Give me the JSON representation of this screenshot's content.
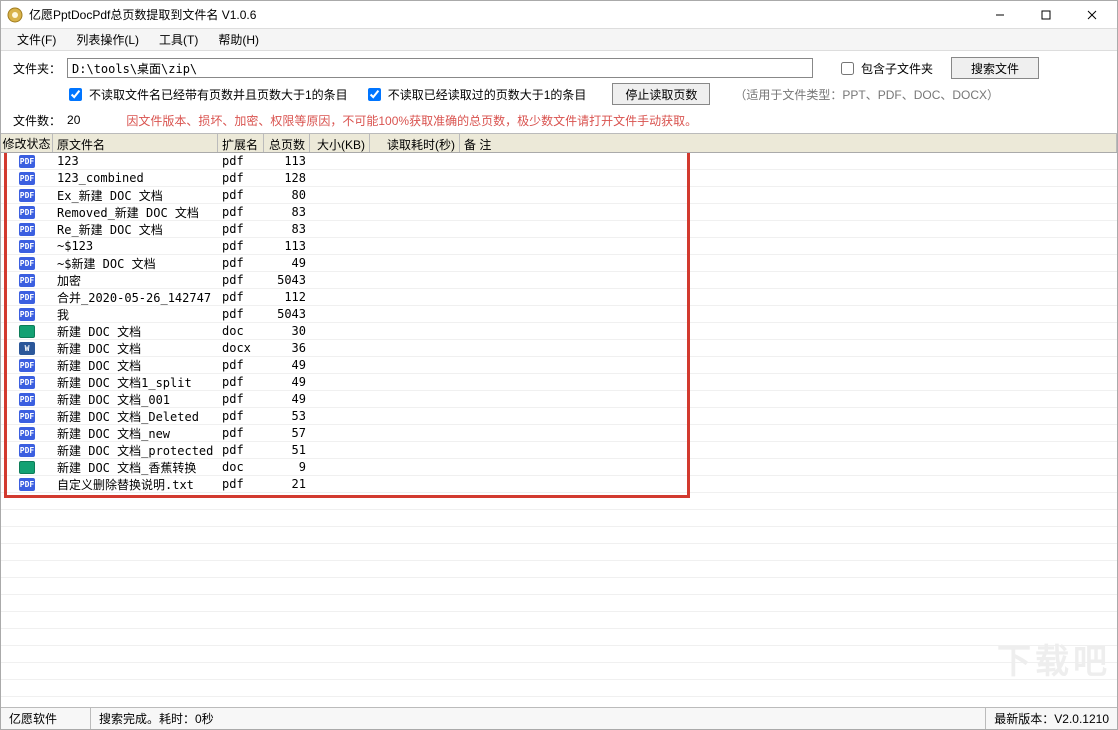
{
  "title": "亿愿PptDocPdf总页数提取到文件名  V1.0.6",
  "menus": {
    "file": "文件(F)",
    "list": "列表操作(L)",
    "tools": "工具(T)",
    "help": "帮助(H)"
  },
  "toolbar": {
    "folder_label": "文件夹：",
    "folder_path": "D:\\tools\\桌面\\zip\\",
    "include_subfolders": "包含子文件夹",
    "search_button": "搜索文件",
    "skip_already_paged": "不读取文件名已经带有页数并且页数大于1的条目",
    "skip_already_read": "不读取已经读取过的页数大于1的条目",
    "stop_button": "停止读取页数",
    "applies_note": "（适用于文件类型：PPT、PDF、DOC、DOCX）",
    "filecount_label": "文件数：",
    "filecount_value": "20",
    "warning": "因文件版本、损坏、加密、权限等原因，不可能100%获取准确的总页数，极少数文件请打开文件手动获取。"
  },
  "columns": {
    "status": "修改状态",
    "name": "原文件名",
    "ext": "扩展名",
    "pages": "总页数",
    "size": "大小(KB)",
    "time": "读取耗时(秒)",
    "note": "备    注"
  },
  "rows": [
    {
      "icon": "pdf",
      "name": "123",
      "ext": "pdf",
      "pages": "113"
    },
    {
      "icon": "pdf",
      "name": "123_combined",
      "ext": "pdf",
      "pages": "128"
    },
    {
      "icon": "pdf",
      "name": "Ex_新建 DOC 文档",
      "ext": "pdf",
      "pages": "80"
    },
    {
      "icon": "pdf",
      "name": "Removed_新建 DOC 文档",
      "ext": "pdf",
      "pages": "83"
    },
    {
      "icon": "pdf",
      "name": "Re_新建 DOC 文档",
      "ext": "pdf",
      "pages": "83"
    },
    {
      "icon": "pdf",
      "name": "~$123",
      "ext": "pdf",
      "pages": "113"
    },
    {
      "icon": "pdf",
      "name": "~$新建 DOC 文档",
      "ext": "pdf",
      "pages": "49"
    },
    {
      "icon": "pdf",
      "name": "加密",
      "ext": "pdf",
      "pages": "5043"
    },
    {
      "icon": "pdf",
      "name": "合并_2020-05-26_142747",
      "ext": "pdf",
      "pages": "112"
    },
    {
      "icon": "pdf",
      "name": "我",
      "ext": "pdf",
      "pages": "5043"
    },
    {
      "icon": "doc",
      "name": "新建 DOC 文档",
      "ext": "doc",
      "pages": "30"
    },
    {
      "icon": "docx",
      "name": "新建 DOC 文档",
      "ext": "docx",
      "pages": "36"
    },
    {
      "icon": "pdf",
      "name": "新建 DOC 文档",
      "ext": "pdf",
      "pages": "49"
    },
    {
      "icon": "pdf",
      "name": "新建 DOC 文档1_split",
      "ext": "pdf",
      "pages": "49"
    },
    {
      "icon": "pdf",
      "name": "新建 DOC 文档_001",
      "ext": "pdf",
      "pages": "49"
    },
    {
      "icon": "pdf",
      "name": "新建 DOC 文档_Deleted",
      "ext": "pdf",
      "pages": "53"
    },
    {
      "icon": "pdf",
      "name": "新建 DOC 文档_new",
      "ext": "pdf",
      "pages": "57"
    },
    {
      "icon": "pdf",
      "name": "新建 DOC 文档_protected",
      "ext": "pdf",
      "pages": "51"
    },
    {
      "icon": "doc",
      "name": "新建 DOC 文档_香蕉转换",
      "ext": "doc",
      "pages": "9"
    },
    {
      "icon": "pdf",
      "name": "自定义删除替换说明.txt",
      "ext": "pdf",
      "pages": "21"
    }
  ],
  "status": {
    "company": "亿愿软件",
    "search_done": "搜索完成。耗时：0秒",
    "version": "最新版本：V2.0.1210"
  },
  "watermark": "下载吧"
}
